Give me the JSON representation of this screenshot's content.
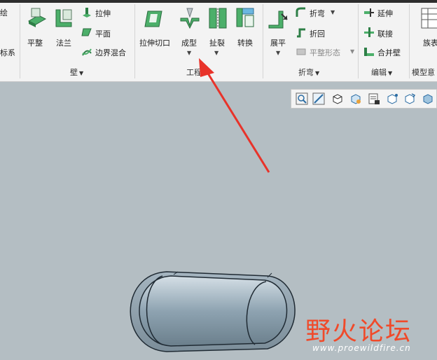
{
  "ribbon": {
    "left_partial": {
      "line1": "绘",
      "line2": "标系"
    },
    "wall": {
      "flat": "平整",
      "flange": "法兰",
      "extrude": "拉伸",
      "planar": "平面",
      "blend": "边界混合",
      "group_label": "壁"
    },
    "engineering": {
      "extrude_cut": "拉伸切口",
      "form": "成型",
      "rip": "扯裂",
      "convert": "转换",
      "group_label": "工程"
    },
    "bend": {
      "unbend": "展平",
      "bend": "折弯",
      "bend_back": "折回",
      "flat_state": "平整形态",
      "group_label": "折弯"
    },
    "edit": {
      "extend": "延伸",
      "join": "联接",
      "merge": "合并壁",
      "group_label": "编辑"
    },
    "model_intent": {
      "family": "族表",
      "group_label": "模型意"
    }
  },
  "watermark": {
    "logo_text": "野火论坛",
    "url": "www.proewildfire.cn"
  },
  "colors": {
    "ribbon_bg": "#f3f3f3",
    "viewport_bg": "#b4bec3",
    "arrow": "#e8332a",
    "accent_green": "#3b9a58"
  },
  "view_toolbar_icons": [
    "zoom-fit-icon",
    "zoom-in-icon",
    "shaded-cube-icon",
    "view-orient-icon",
    "layer-icon",
    "camera-icon",
    "datum-display-icon",
    "spin-center-icon",
    "display-style-icon"
  ]
}
